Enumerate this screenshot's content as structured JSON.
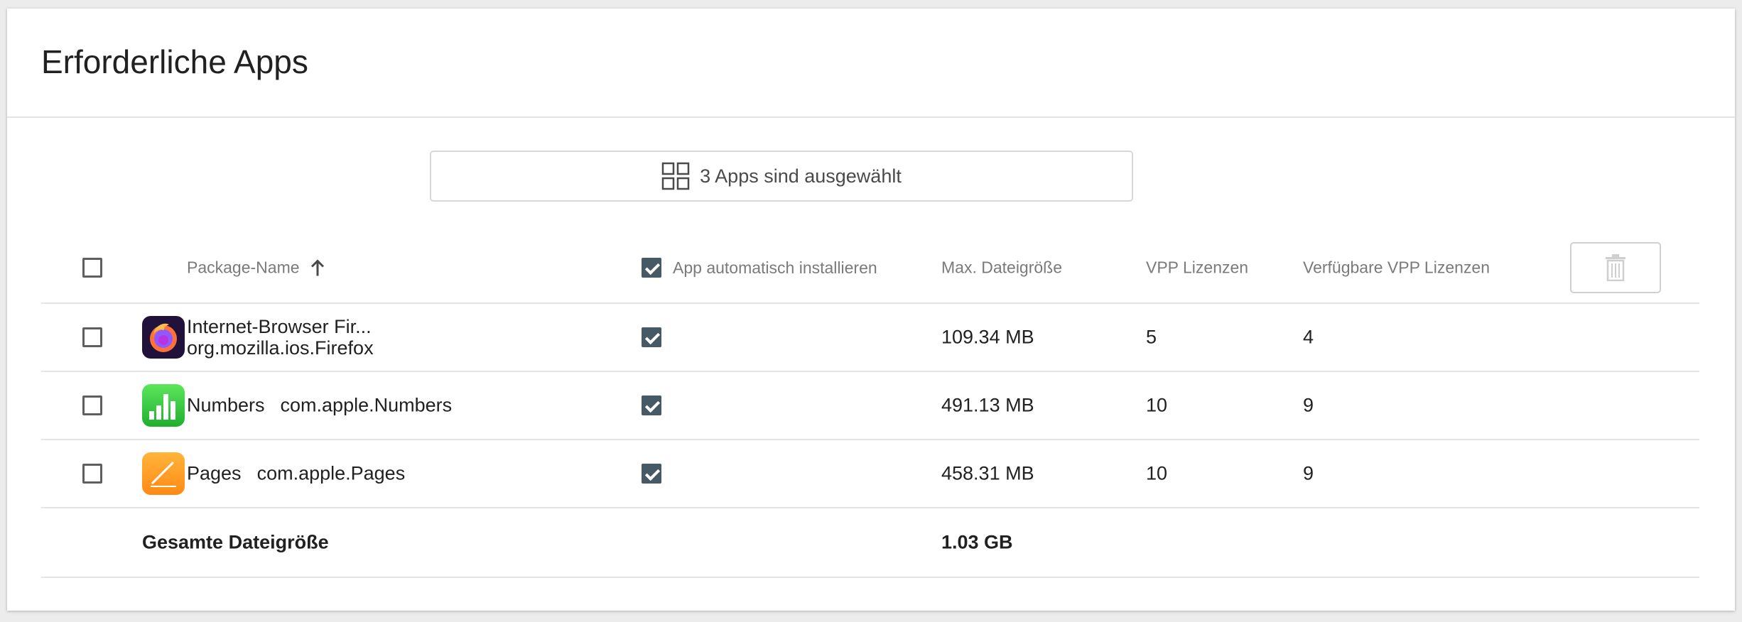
{
  "page_title": "Erforderliche Apps",
  "selector": {
    "label": "3 Apps sind ausgewählt",
    "icon": "grid-icon"
  },
  "columns": {
    "package_name": "Package-Name",
    "sort_icon": "arrow-up-icon",
    "auto_install": "App automatisch installieren",
    "max_size": "Max. Dateigröße",
    "vpp": "VPP Lizenzen",
    "vpp_available": "Verfügbare VPP Lizenzen",
    "delete_icon": "trash-icon"
  },
  "rows": [
    {
      "icon": "firefox-icon",
      "name": "Internet-Browser Fir...",
      "package": "org.mozilla.ios.Firefox",
      "auto_install": true,
      "size": "109.34 MB",
      "vpp": "5",
      "vpp_available": "4"
    },
    {
      "icon": "numbers-icon",
      "name": "Numbers",
      "package": "com.apple.Numbers",
      "auto_install": true,
      "size": "491.13 MB",
      "vpp": "10",
      "vpp_available": "9"
    },
    {
      "icon": "pages-icon",
      "name": "Pages",
      "package": "com.apple.Pages",
      "auto_install": true,
      "size": "458.31 MB",
      "vpp": "10",
      "vpp_available": "9"
    }
  ],
  "total": {
    "label": "Gesamte Dateigröße",
    "value": "1.03 GB"
  },
  "colors": {
    "checkbox_checked": "#455a64",
    "divider": "#e4e4e4"
  }
}
